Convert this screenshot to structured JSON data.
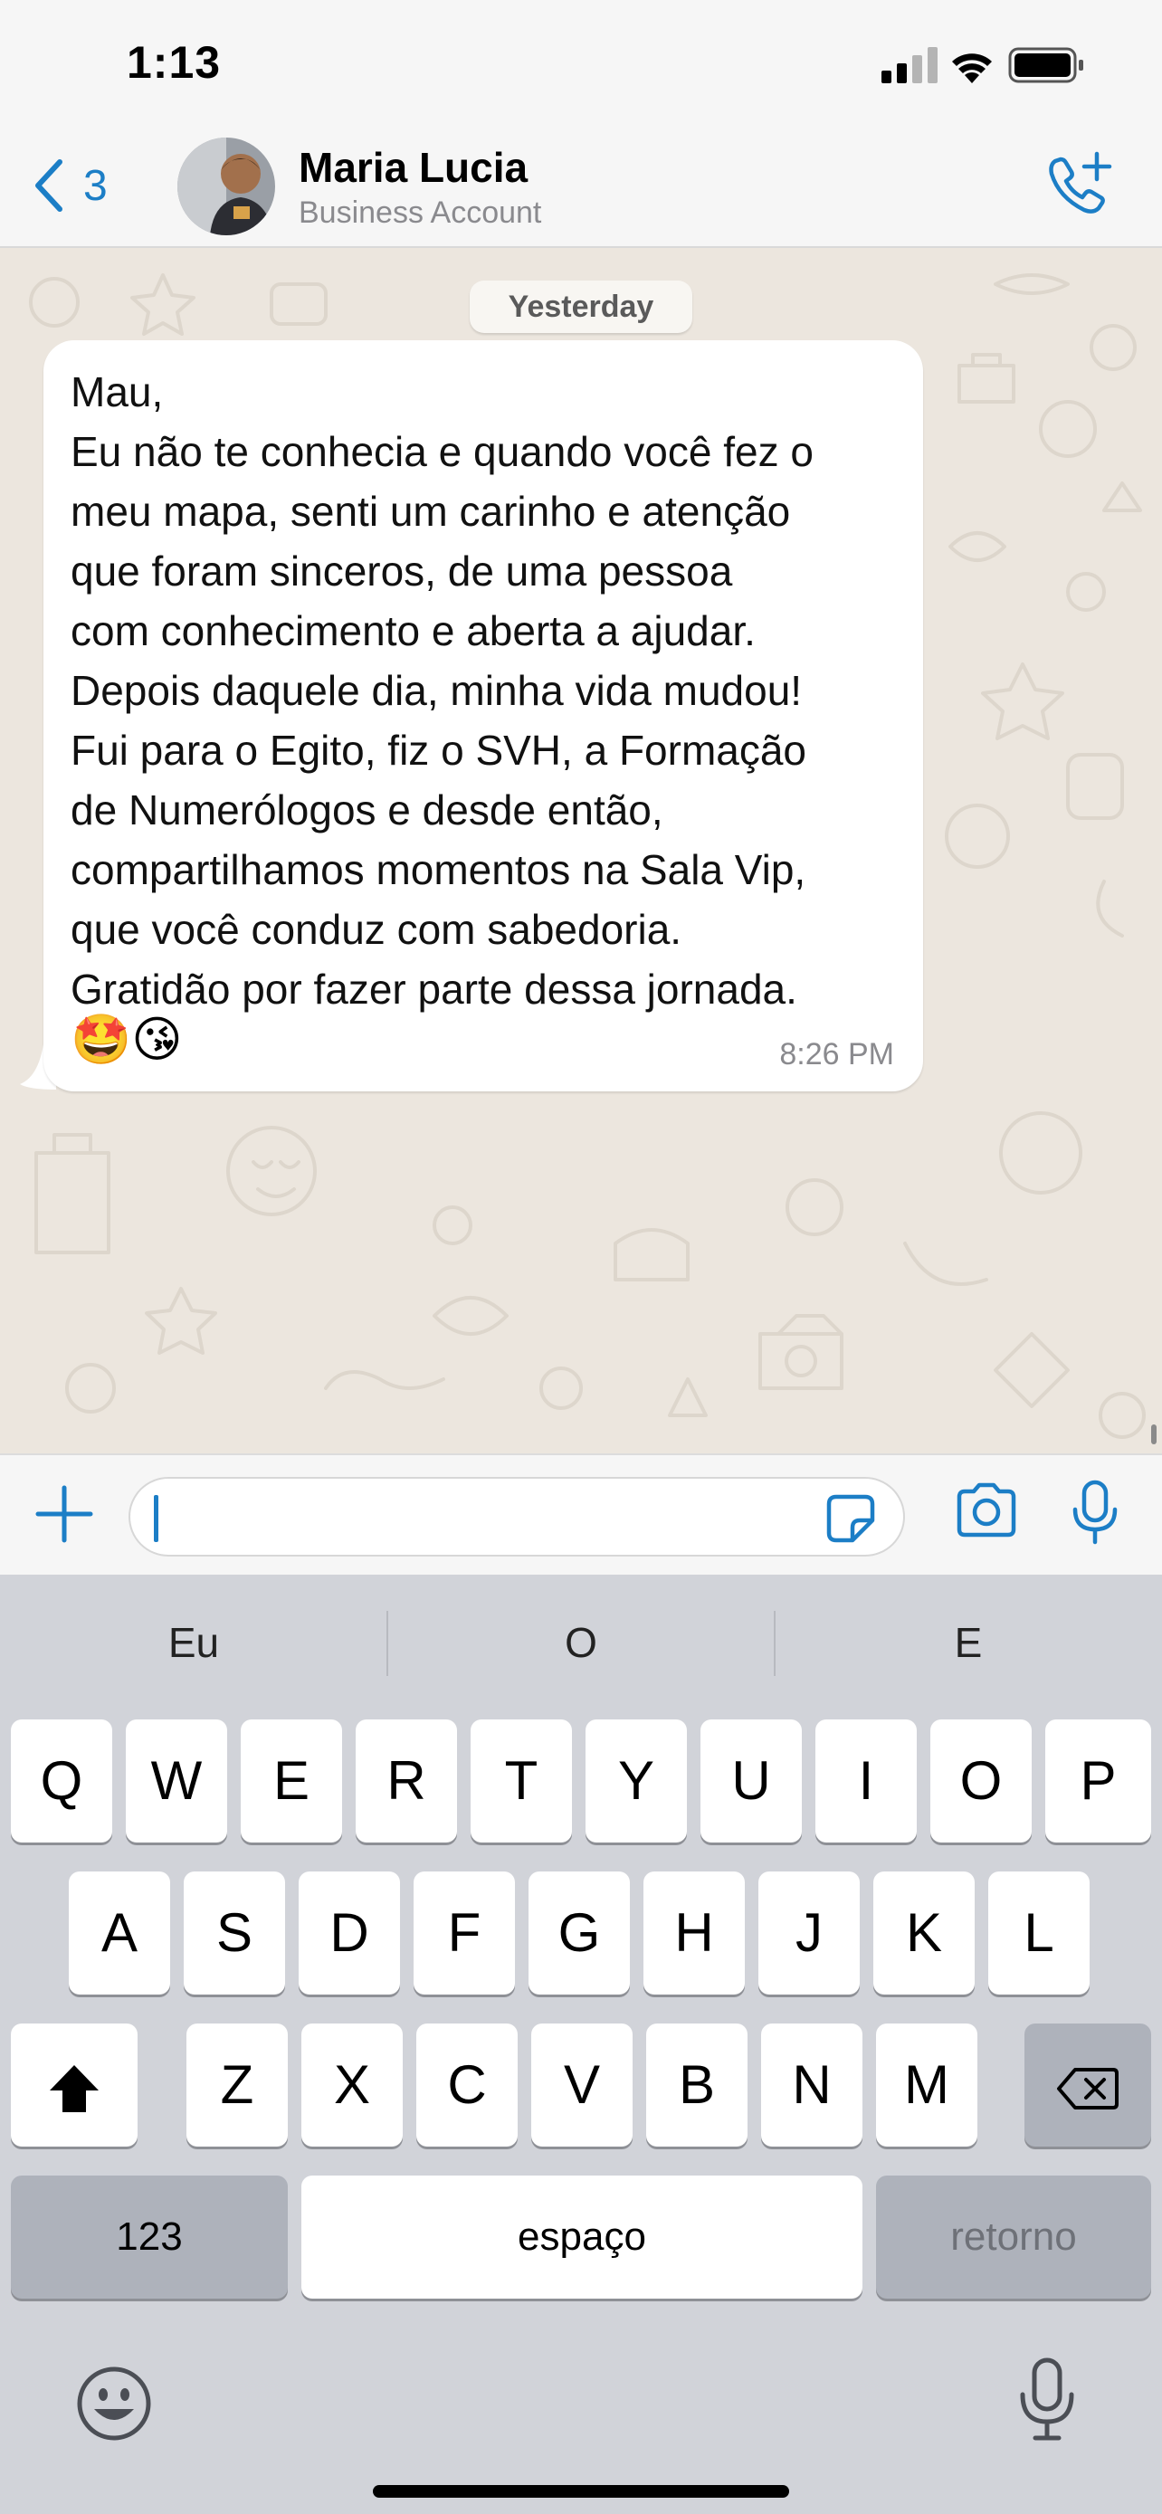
{
  "status_bar": {
    "time": "1:13"
  },
  "header": {
    "back_count": "3",
    "contact_name": "Maria Lucia",
    "contact_subtitle": "Business Account",
    "call_icon": "phone-plus-icon"
  },
  "chat": {
    "date_label": "Yesterday",
    "messages": [
      {
        "direction": "incoming",
        "text": "Mau,\nEu não te conhecia e quando você fez o\nmeu mapa, senti um carinho e atenção\nque foram sinceros, de uma pessoa\ncom conhecimento e aberta a ajudar.\nDepois daquele dia, minha vida mudou!\nFui para o Egito, fiz o SVH, a Formação\nde Numerólogos e desde então,\ncompartilhamos momentos na Sala Vip,\nque você conduz com sabedoria.\nGratidão por fazer parte dessa jornada.",
        "emojis": "🤩😘",
        "time": "8:26 PM"
      }
    ]
  },
  "composer": {
    "input_value": "",
    "icons": [
      "plus-icon",
      "sticker-icon",
      "camera-icon",
      "microphone-icon"
    ]
  },
  "keyboard": {
    "predictions": [
      "Eu",
      "O",
      "E"
    ],
    "row1": [
      "Q",
      "W",
      "E",
      "R",
      "T",
      "Y",
      "U",
      "I",
      "O",
      "P"
    ],
    "row2": [
      "A",
      "S",
      "D",
      "F",
      "G",
      "H",
      "J",
      "K",
      "L"
    ],
    "row3": [
      "Z",
      "X",
      "C",
      "V",
      "B",
      "N",
      "M"
    ],
    "numbers_key": "123",
    "space_key": "espaço",
    "return_key": "retorno"
  },
  "colors": {
    "accent": "#1c7ec6",
    "chat_background": "#ece6de",
    "keyboard_background": "#d1d3d9"
  }
}
